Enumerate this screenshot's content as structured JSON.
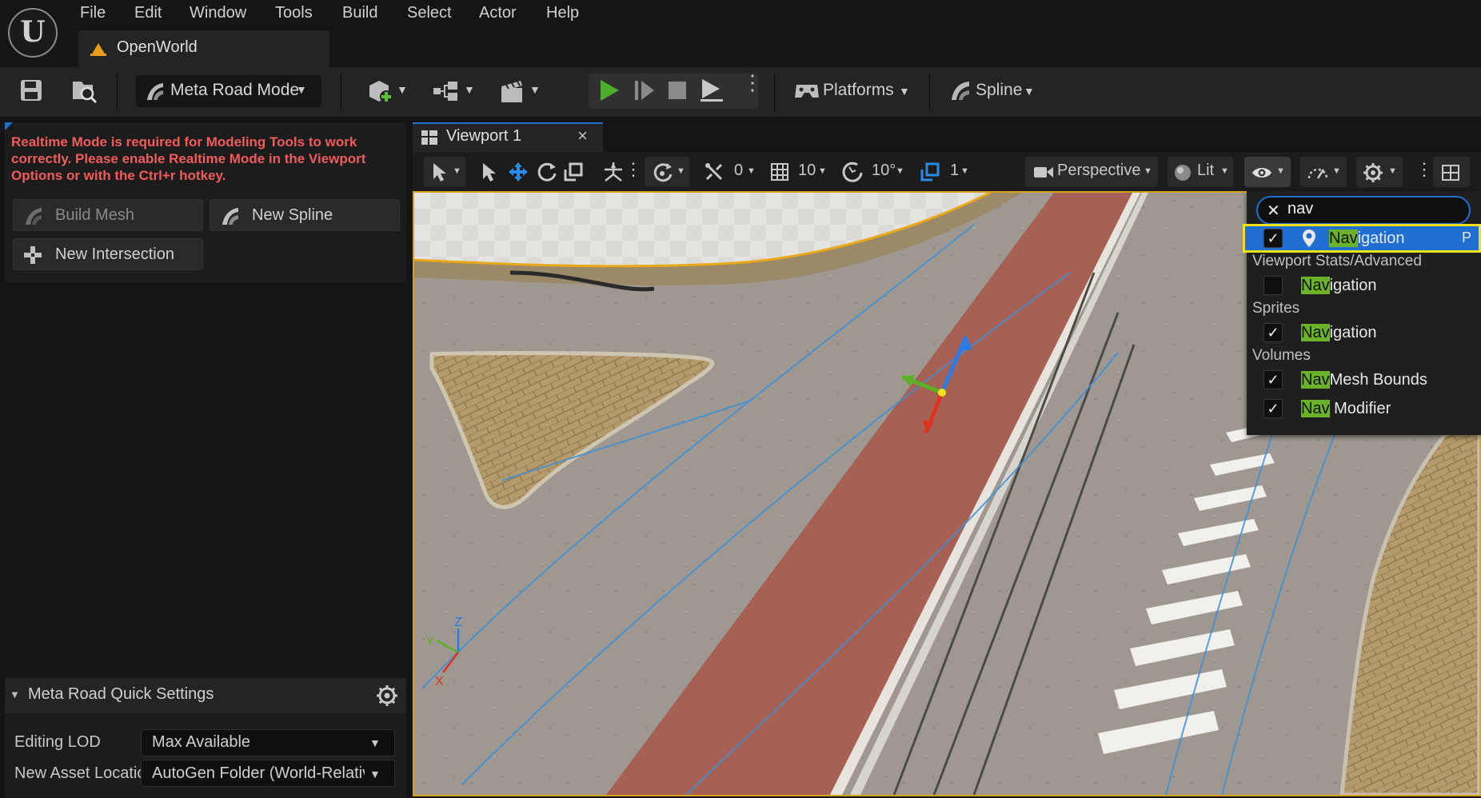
{
  "menu": {
    "file": "File",
    "edit": "Edit",
    "window": "Window",
    "tools": "Tools",
    "build": "Build",
    "select": "Select",
    "actor": "Actor",
    "help": "Help"
  },
  "project": {
    "name": "OpenWorld"
  },
  "toolbar": {
    "mode_label": "Meta Road Mode",
    "platforms_label": "Platforms",
    "spline_label": "Spline"
  },
  "left_panel": {
    "warning": "Realtime Mode is required for Modeling Tools to work correctly. Please enable Realtime Mode in the Viewport Options or with the Ctrl+r hotkey.",
    "build_mesh": "Build Mesh",
    "new_spline": "New Spline",
    "new_intersection": "New Intersection"
  },
  "quick_settings": {
    "title": "Meta Road Quick Settings",
    "editing_lod_label": "Editing LOD",
    "editing_lod_value": "Max Available",
    "new_asset_label": "New Asset Locatic",
    "new_asset_value": "AutoGen Folder (World-Relativ"
  },
  "viewport": {
    "tab_title": "Viewport 1",
    "close": "×",
    "translate_snap": "0",
    "grid_snap": "10",
    "rotate_snap": "10°",
    "scale_snap": "1",
    "perspective": "Perspective",
    "lit": "Lit"
  },
  "show_menu": {
    "search": "nav",
    "top_item": {
      "hl": "Nav",
      "rest": "igation",
      "shortcut": "P",
      "checked": true
    },
    "sections": [
      {
        "title": "Viewport Stats/Advanced",
        "items": [
          {
            "hl": "Nav",
            "rest": "igation",
            "checked": false
          }
        ]
      },
      {
        "title": "Sprites",
        "items": [
          {
            "hl": "Nav",
            "rest": "igation",
            "checked": true
          }
        ]
      },
      {
        "title": "Volumes",
        "items": [
          {
            "hl": "Nav",
            "rest": "Mesh Bounds",
            "checked": true
          },
          {
            "hl": "Nav",
            "rest": " Modifier",
            "checked": true
          }
        ]
      }
    ]
  },
  "gizmo": {
    "x": "X",
    "y": "Y",
    "z": "Z"
  },
  "colors": {
    "accent": "#1f6fd1",
    "highlight": "#6cb12a",
    "warning": "#f05c5c",
    "play": "#4caf2a",
    "selection_outline": "#f2e21a"
  }
}
